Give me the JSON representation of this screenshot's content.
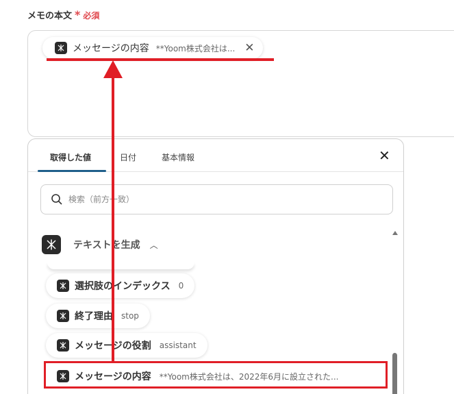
{
  "field": {
    "label": "メモの本文",
    "required_star": "*",
    "required_text": "必須"
  },
  "memo_chip": {
    "label": "メッセージの内容",
    "value": "**Yoom株式会社は...",
    "close": "✕"
  },
  "panel": {
    "tabs": [
      {
        "label": "取得した値"
      },
      {
        "label": "日付"
      },
      {
        "label": "基本情報"
      }
    ],
    "close": "✕",
    "search": {
      "placeholder": "検索（前方一致）"
    },
    "group": {
      "title": "テキストを生成",
      "chevron": "︿"
    },
    "items": [
      {
        "label": "選択肢のインデックス",
        "value": "0"
      },
      {
        "label": "終了理由",
        "value": "stop"
      },
      {
        "label": "メッセージの役割",
        "value": "assistant"
      },
      {
        "label": "メッセージの内容",
        "value": "**Yoom株式会社は、2022年6月に設立された..."
      }
    ]
  },
  "colors": {
    "highlight": "#e01e26",
    "required": "#e0484d",
    "tab_active": "#1f5f8b",
    "icon_bg": "#2b2b2b"
  }
}
